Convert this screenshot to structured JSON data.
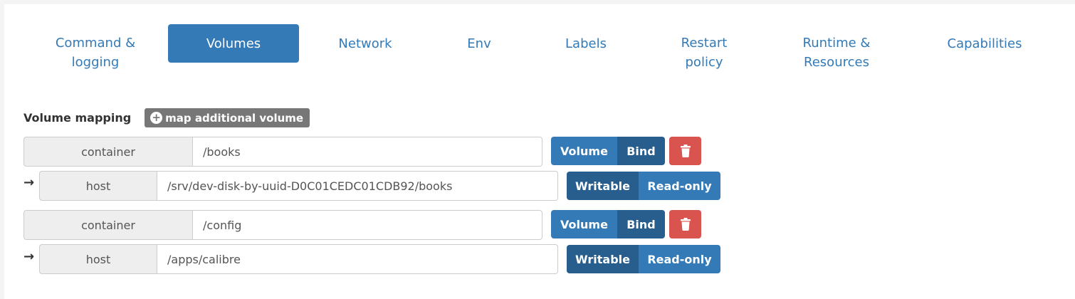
{
  "tabs": [
    {
      "label": "Command & logging",
      "active": false
    },
    {
      "label": "Volumes",
      "active": true
    },
    {
      "label": "Network",
      "active": false
    },
    {
      "label": "Env",
      "active": false
    },
    {
      "label": "Labels",
      "active": false
    },
    {
      "label": "Restart policy",
      "active": false
    },
    {
      "label": "Runtime & Resources",
      "active": false
    },
    {
      "label": "Capabilities",
      "active": false
    }
  ],
  "volume_mapping": {
    "label": "Volume mapping",
    "add_button": "map additional volume",
    "add_icon": "plus-circle-icon",
    "container_label": "container",
    "host_label": "host",
    "type_buttons": {
      "volume": "Volume",
      "bind": "Bind"
    },
    "mode_buttons": {
      "writable": "Writable",
      "readonly": "Read-only"
    },
    "delete_icon": "trash-icon",
    "arrow": "→",
    "mappings": [
      {
        "container": "/books",
        "host": "/srv/dev-disk-by-uuid-D0C01CEDC01CDB92/books",
        "type": "Bind",
        "mode": "Writable"
      },
      {
        "container": "/config",
        "host": "/apps/calibre",
        "type": "Bind",
        "mode": "Writable"
      }
    ]
  },
  "colors": {
    "primary": "#337ab7",
    "primary_active": "#285e8e",
    "danger": "#d9534f",
    "muted": "#777777"
  }
}
